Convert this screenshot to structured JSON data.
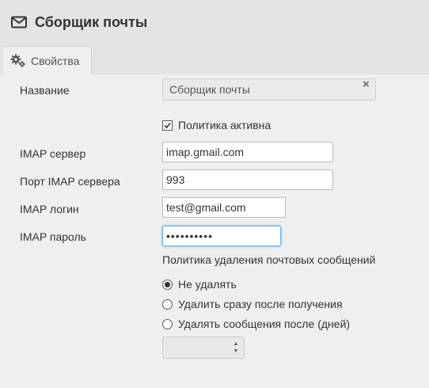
{
  "header": {
    "title": "Сборщик почты",
    "icon": "envelope-icon"
  },
  "tabs": [
    {
      "label": "Свойства",
      "icon": "gears-icon",
      "active": true
    }
  ],
  "form": {
    "name": {
      "label": "Название",
      "value": "Сборщик почты"
    },
    "policy_active": {
      "label": "Политика активна",
      "checked": true
    },
    "imap_server": {
      "label": "IMAP сервер",
      "value": "imap.gmail.com"
    },
    "imap_port": {
      "label": "Порт IMAP сервера",
      "value": "993"
    },
    "imap_login": {
      "label": "IMAP логин",
      "value": "test@gmail.com"
    },
    "imap_password": {
      "label": "IMAP пароль",
      "value": "••••••••••"
    },
    "deletion_policy": {
      "title": "Политика удаления почтовых сообщений",
      "options": [
        {
          "label": "Не удалять",
          "selected": true
        },
        {
          "label": "Удалить сразу после получения",
          "selected": false
        },
        {
          "label": "Удалять сообщения после (дней)",
          "selected": false
        }
      ],
      "days_value": ""
    }
  }
}
